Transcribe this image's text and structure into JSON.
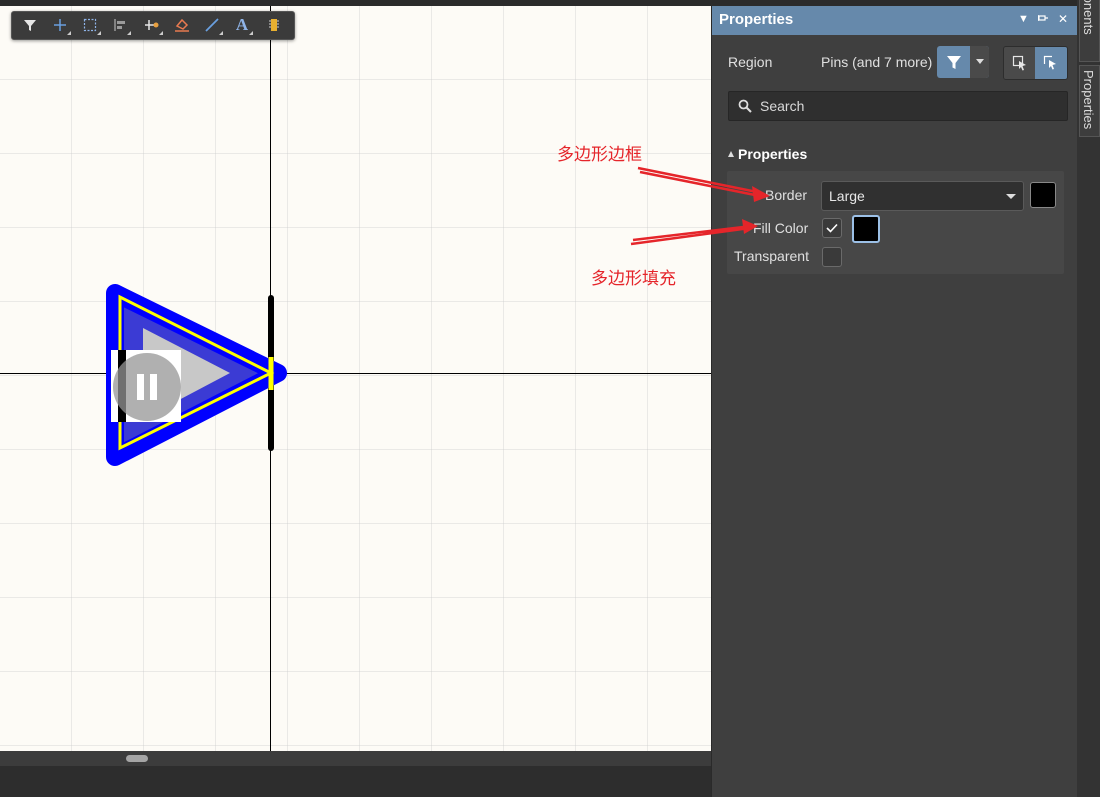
{
  "toolbar": {
    "tools": [
      {
        "icon": "filter-icon"
      },
      {
        "icon": "crosshair-icon"
      },
      {
        "icon": "select-rect-icon"
      },
      {
        "icon": "align-icon"
      },
      {
        "icon": "pin-icon"
      },
      {
        "icon": "eraser-icon"
      },
      {
        "icon": "line-icon"
      },
      {
        "icon": "text-icon",
        "glyph": "A"
      },
      {
        "icon": "component-icon"
      }
    ]
  },
  "colors": {
    "border_blue": "#0000ff",
    "fill_blue": "#3b3bd4",
    "outline_yellow": "#ffff00",
    "panel_header": "#6689ab",
    "annotation": "#e5252a"
  },
  "panel": {
    "title": "Properties",
    "region_label": "Region",
    "selection_text": "Pins (and 7 more)",
    "search_placeholder": "Search",
    "section_title": "Properties",
    "properties": {
      "border_label": "Border",
      "border_value": "Large",
      "fill_color_label": "Fill Color",
      "fill_color_checked": true,
      "transparent_label": "Transparent",
      "transparent_checked": false
    }
  },
  "side_tabs": [
    "Components",
    "Properties"
  ],
  "annotations": {
    "border_note": "多边形边框",
    "fill_note": "多边形填充"
  }
}
